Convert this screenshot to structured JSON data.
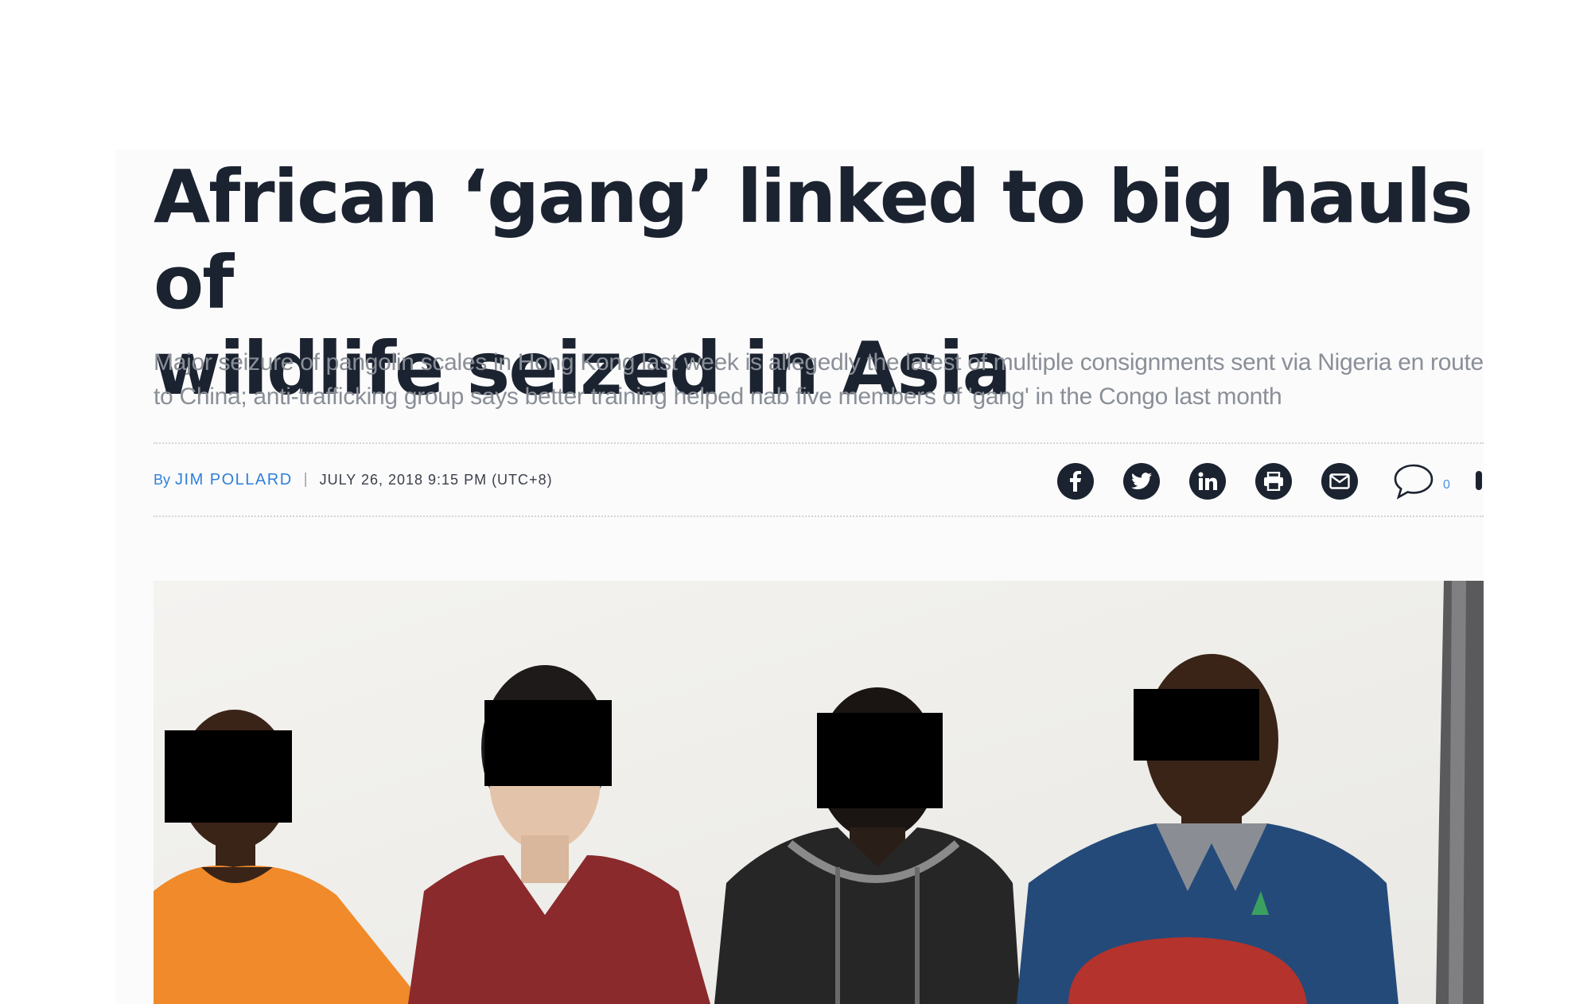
{
  "article": {
    "headline_line1": "African ‘gang’ linked to big hauls of",
    "headline_line2": "wildlife seized in Asia",
    "subhead": "Major seizure of pangolin scales in Hong Kong last week is allegedly the latest of multiple consignments sent via Nigeria en route to China; anti-trafficking group says better training helped nab five members of 'gang' in the Congo last month",
    "byline": {
      "prefix": "By",
      "author": "JIM POLLARD",
      "separator": "|",
      "date": "JULY 26, 2018 9:15 PM (UTC+8)"
    }
  },
  "share": {
    "icons": [
      "facebook-icon",
      "twitter-icon",
      "linkedin-icon",
      "print-icon",
      "email-icon",
      "comment-icon"
    ],
    "comment_count": "0"
  },
  "photo": {
    "description": "photo-of-four-men-with-censored-eyes"
  },
  "colors": {
    "headline": "#1c2330",
    "subhead": "#8a8f97",
    "link": "#2f7fd8",
    "icon_bg": "#1c2330"
  }
}
